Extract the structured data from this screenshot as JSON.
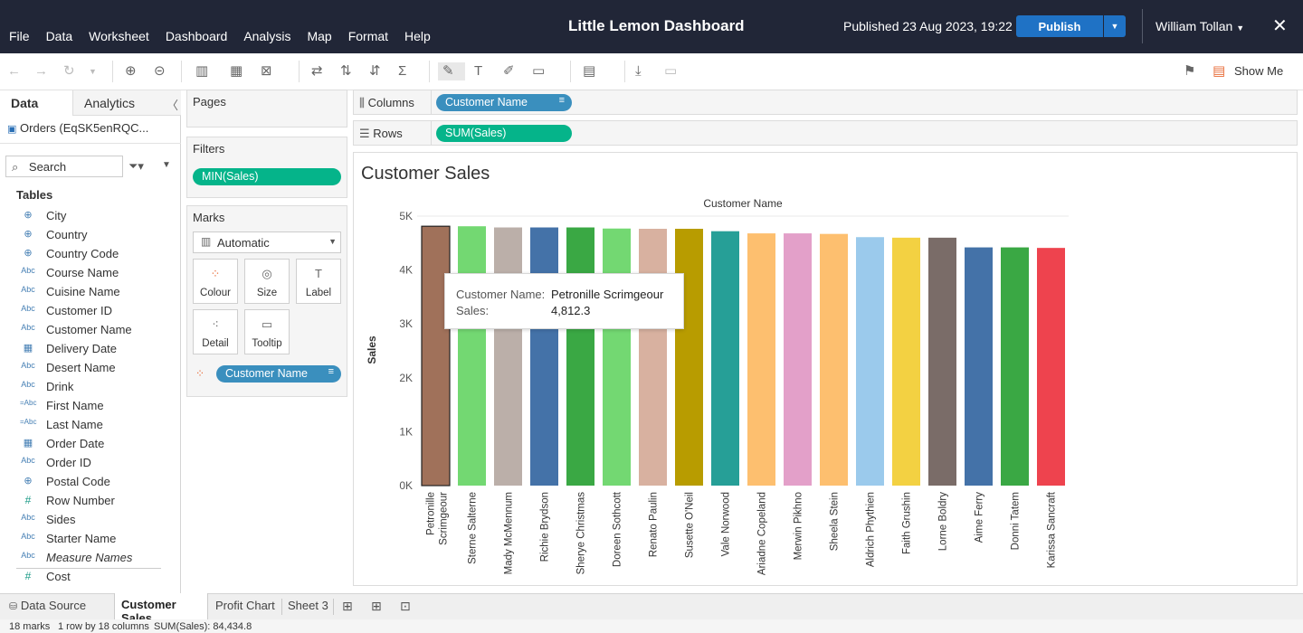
{
  "menu": [
    "File",
    "Data",
    "Worksheet",
    "Dashboard",
    "Analysis",
    "Map",
    "Format",
    "Help"
  ],
  "app_title": "Little Lemon Dashboard",
  "published": "Published 23 Aug 2023, 19:22",
  "publish_label": "Publish",
  "user_label": "William Tollan",
  "toolbar": {
    "show_me": "Show Me"
  },
  "data_pane": {
    "tab_data": "Data",
    "tab_analytics": "Analytics",
    "datasource": "Orders (EqSK5enRQC...",
    "search_placeholder": "Search",
    "tables_heading": "Tables",
    "fields": [
      {
        "type": "geo",
        "name": "City"
      },
      {
        "type": "geo",
        "name": "Country"
      },
      {
        "type": "geo",
        "name": "Country Code"
      },
      {
        "type": "abc",
        "name": "Course Name"
      },
      {
        "type": "abc",
        "name": "Cuisine Name"
      },
      {
        "type": "abc",
        "name": "Customer ID"
      },
      {
        "type": "abc",
        "name": "Customer Name"
      },
      {
        "type": "date",
        "name": "Delivery Date"
      },
      {
        "type": "abc",
        "name": "Desert Name"
      },
      {
        "type": "abc",
        "name": "Drink"
      },
      {
        "type": "calc",
        "name": "First Name"
      },
      {
        "type": "calc",
        "name": "Last Name"
      },
      {
        "type": "date",
        "name": "Order Date"
      },
      {
        "type": "abc",
        "name": "Order ID"
      },
      {
        "type": "geo",
        "name": "Postal Code"
      },
      {
        "type": "num",
        "name": "Row Number"
      },
      {
        "type": "abc",
        "name": "Sides"
      },
      {
        "type": "abc",
        "name": "Starter Name"
      },
      {
        "type": "abc",
        "name": "Measure Names"
      },
      {
        "type": "num",
        "name": "Cost"
      }
    ]
  },
  "pages_label": "Pages",
  "filters_label": "Filters",
  "filter_pill": "MIN(Sales)",
  "marks": {
    "label": "Marks",
    "type": "Automatic",
    "buttons": [
      "Colour",
      "Size",
      "Label",
      "Detail",
      "Tooltip"
    ],
    "color_field": "Customer Name"
  },
  "columns_label": "Columns",
  "rows_label": "Rows",
  "columns_pill": "Customer Name",
  "rows_pill": "SUM(Sales)",
  "tooltip": {
    "k1": "Customer Name:",
    "v1": "Petronille Scrimgeour",
    "k2": "Sales:",
    "v2": "4,812.3"
  },
  "chart_data": {
    "type": "bar",
    "title": "Customer Sales",
    "xlabel": "Customer Name",
    "ylabel": "Sales",
    "ylim": [
      0,
      5000
    ],
    "yticks": [
      "0K",
      "1K",
      "2K",
      "3K",
      "4K",
      "5K"
    ],
    "categories": [
      "Petronille Scrimgeour",
      "Sterne Salterne",
      "Mady McMennum",
      "Richie Brydson",
      "Sherye Christmas",
      "Doreen Sothcott",
      "Renato Paulin",
      "Susette O'Neil",
      "Vale Norwood",
      "Ariadne Copeland",
      "Merwin Pikhno",
      "Sheela Stein",
      "Aldrich Phythien",
      "Faith Grushin",
      "Lorne Boldry",
      "Aime Ferry",
      "Donni Tatem",
      "Karissa Sancraft"
    ],
    "values": [
      4812.3,
      4812,
      4790,
      4790,
      4790,
      4770,
      4765,
      4765,
      4720,
      4680,
      4680,
      4670,
      4610,
      4600,
      4600,
      4420,
      4420,
      4410
    ],
    "colors": [
      "#a0715a",
      "#73d872",
      "#bbafa9",
      "#4472a8",
      "#3aa844",
      "#73d872",
      "#d8b1a0",
      "#b89c00",
      "#269f97",
      "#fdbf6f",
      "#e3a0c9",
      "#fdbf6f",
      "#9bcaec",
      "#f3d142",
      "#7a6c68",
      "#4472a8",
      "#3aa844",
      "#ee434e"
    ],
    "selected": 0
  },
  "sheet_tabs": {
    "data_source": "Data Source",
    "tabs": [
      "Customer Sales",
      "Profit Chart",
      "Sheet 3"
    ]
  },
  "status": {
    "marks": "18 marks",
    "dims": "1 row by 18 columns",
    "sum": "SUM(Sales): 84,434.8"
  }
}
